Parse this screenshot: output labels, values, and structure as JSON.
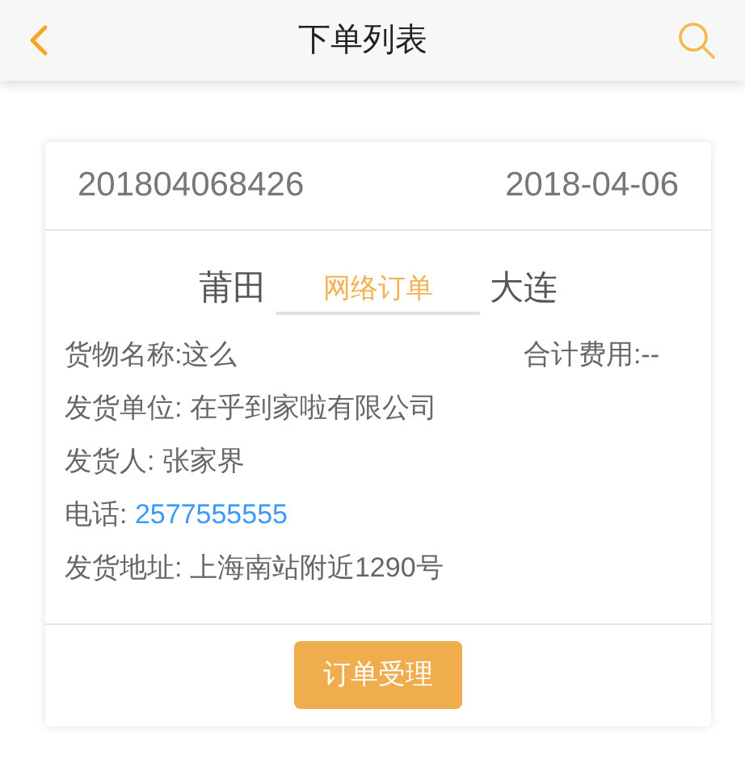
{
  "header": {
    "title": "下单列表"
  },
  "order": {
    "number": "201804068426",
    "date": "2018-04-06",
    "origin": "莆田",
    "order_type": "网络订单",
    "destination": "大连",
    "fee": {
      "label": "合计费用:",
      "value": "--"
    },
    "details": [
      {
        "label": "货物名称:",
        "value": "这么",
        "kind": "text"
      },
      {
        "label": "发货单位: ",
        "value": "在乎到家啦有限公司",
        "kind": "text"
      },
      {
        "label": "发货人: ",
        "value": "张家界",
        "kind": "text"
      },
      {
        "label": "电话: ",
        "value": "2577555555",
        "kind": "phone"
      },
      {
        "label": "发货地址: ",
        "value": "上海南站附近1290号",
        "kind": "text"
      }
    ],
    "action": "订单受理"
  }
}
